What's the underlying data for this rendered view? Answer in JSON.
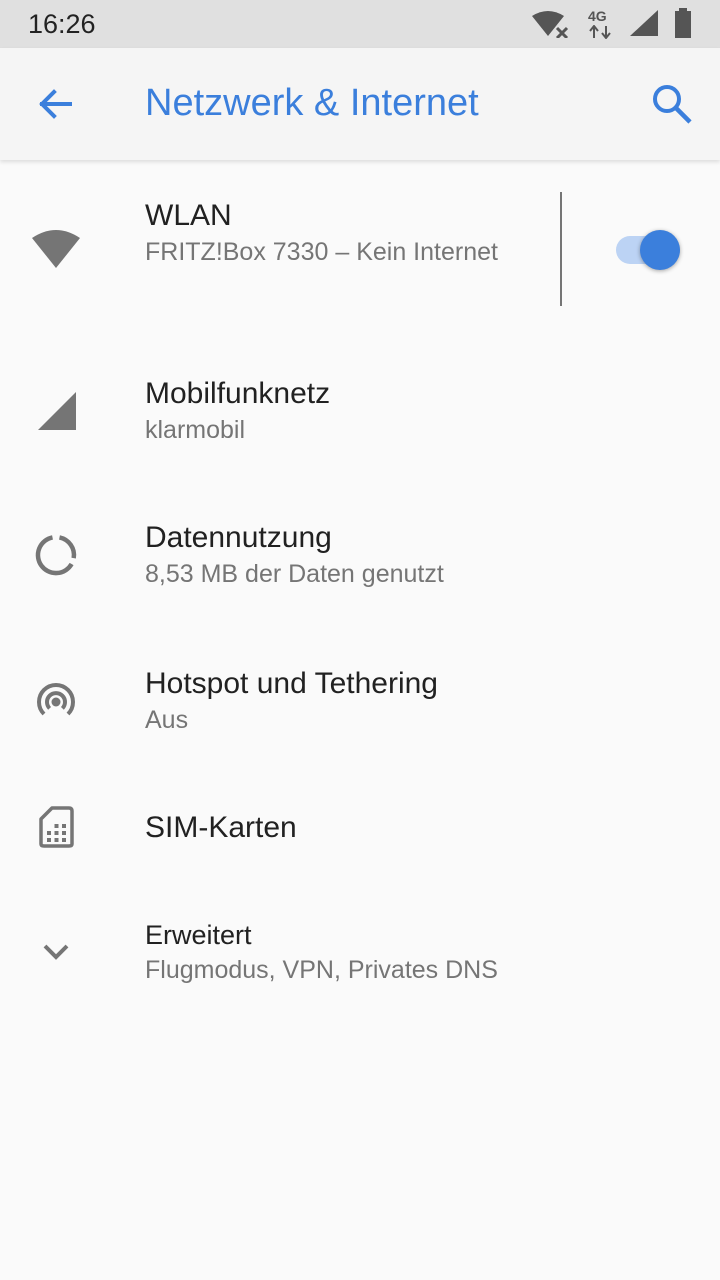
{
  "status_bar": {
    "time": "16:26",
    "network_type": "4G",
    "icons": [
      "wifi-no-internet-icon",
      "mobile-data-4g-icon",
      "cell-signal-icon",
      "battery-icon"
    ]
  },
  "app_bar": {
    "title": "Netzwerk & Internet",
    "back_icon": "arrow-back-icon",
    "search_icon": "search-icon"
  },
  "settings": [
    {
      "title": "WLAN",
      "summary": "FRITZ!Box 7330 – Kein Internet",
      "icon": "wifi-icon",
      "toggle_on": true
    },
    {
      "title": "Mobilfunknetz",
      "summary": "klarmobil",
      "icon": "cell-signal-icon"
    },
    {
      "title": "Datennutzung",
      "summary": "8,53 MB der Daten genutzt",
      "icon": "data-usage-icon"
    },
    {
      "title": "Hotspot und Tethering",
      "summary": "Aus",
      "icon": "hotspot-icon"
    },
    {
      "title": "SIM-Karten",
      "summary": "",
      "icon": "sim-card-icon"
    },
    {
      "title": "Erweitert",
      "summary": "Flugmodus, VPN, Privates DNS",
      "icon": "chevron-down-icon"
    }
  ],
  "colors": {
    "accent": "#3b7fdc",
    "status_bar_bg": "#e0e0e0",
    "app_bar_bg": "#f5f5f5",
    "background": "#fafafa",
    "primary_text": "#212121",
    "secondary_text": "#757575",
    "icon": "#757575"
  }
}
